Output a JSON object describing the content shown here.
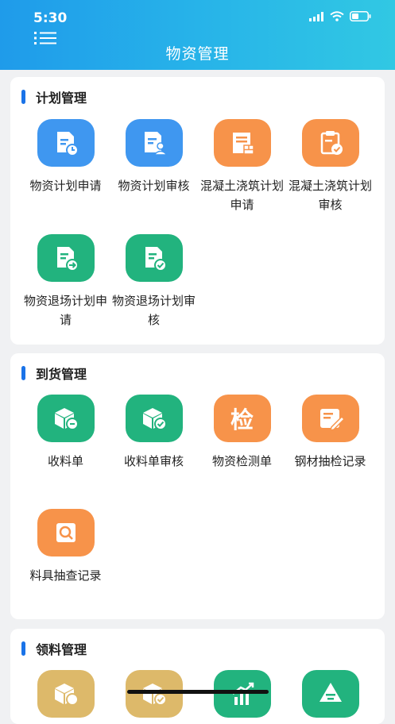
{
  "status": {
    "time": "5:30"
  },
  "header": {
    "title": "物资管理"
  },
  "sections": [
    {
      "title": "计划管理",
      "items": [
        {
          "label": "物资计划申请",
          "icon": "doc-clock-icon",
          "color": "#3f97f0"
        },
        {
          "label": "物资计划审核",
          "icon": "doc-user-icon",
          "color": "#3f97f0"
        },
        {
          "label": "混凝土浇筑计划申请",
          "icon": "wall-doc-icon",
          "color": "#f7934a"
        },
        {
          "label": "混凝土浇筑计划审核",
          "icon": "clipboard-check-icon",
          "color": "#f7934a"
        },
        {
          "label": "物资退场计划申请",
          "icon": "doc-arrow-icon",
          "color": "#22b37e"
        },
        {
          "label": "物资退场计划审核",
          "icon": "doc-check-icon",
          "color": "#22b37e"
        }
      ]
    },
    {
      "title": "到货管理",
      "items": [
        {
          "label": "收料单",
          "icon": "box-receive-icon",
          "color": "#22b37e"
        },
        {
          "label": "收料单审核",
          "icon": "box-check-icon",
          "color": "#22b37e"
        },
        {
          "label": "物资检测单",
          "icon": "inspect-char-icon",
          "icon_text": "检",
          "color": "#f7934a"
        },
        {
          "label": "钢材抽检记录",
          "icon": "doc-edit-icon",
          "color": "#f7934a"
        },
        {
          "label": "料具抽查记录",
          "icon": "search-doc-icon",
          "color": "#f7934a"
        }
      ]
    },
    {
      "title": "领料管理",
      "items": [
        {
          "icon": "box-coin-icon",
          "color": "#ddb96a"
        },
        {
          "icon": "box-check-icon",
          "color": "#ddb96a"
        },
        {
          "icon": "chart-up-icon",
          "color": "#22b37e"
        },
        {
          "icon": "triangle-doc-icon",
          "color": "#22b37e"
        }
      ]
    }
  ]
}
